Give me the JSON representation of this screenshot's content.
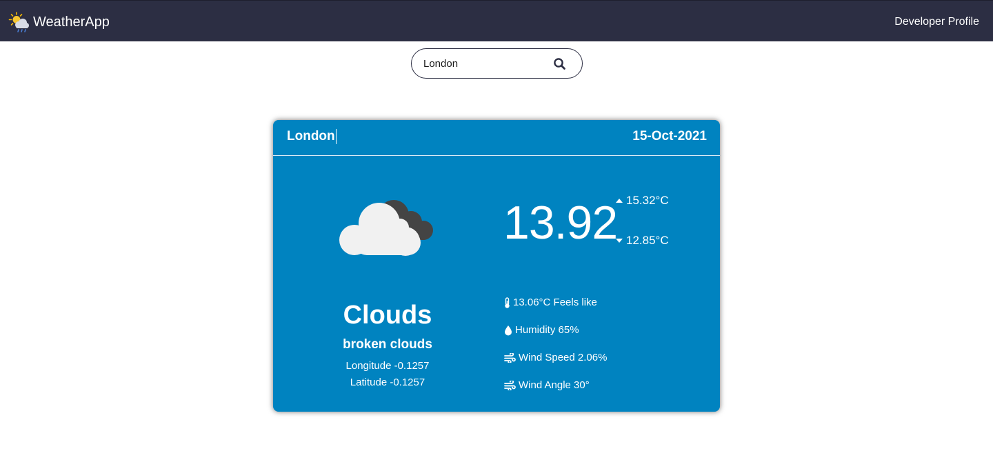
{
  "navbar": {
    "brand": "WeatherApp",
    "logo_icon": "sun-cloud-rain-icon",
    "link": "Developer Profile"
  },
  "search": {
    "value": "London",
    "icon": "search-icon"
  },
  "card": {
    "city": "London",
    "date": "15-Oct-2021",
    "icon": "broken-clouds-icon",
    "temp": "13.92",
    "temp_max": "15.32°C",
    "temp_min": "12.85°C",
    "main": "Clouds",
    "description": "broken clouds",
    "longitude": "Longitude -0.1257",
    "latitude": "Latitude -0.1257",
    "feels_like": "13.06°C Feels like",
    "humidity": "Humidity 65%",
    "wind_speed": "Wind Speed 2.06%",
    "wind_angle": "Wind Angle 30°"
  },
  "colors": {
    "navbar": "#2c2e43",
    "card": "#0083c0",
    "text_light": "#ffffff"
  }
}
